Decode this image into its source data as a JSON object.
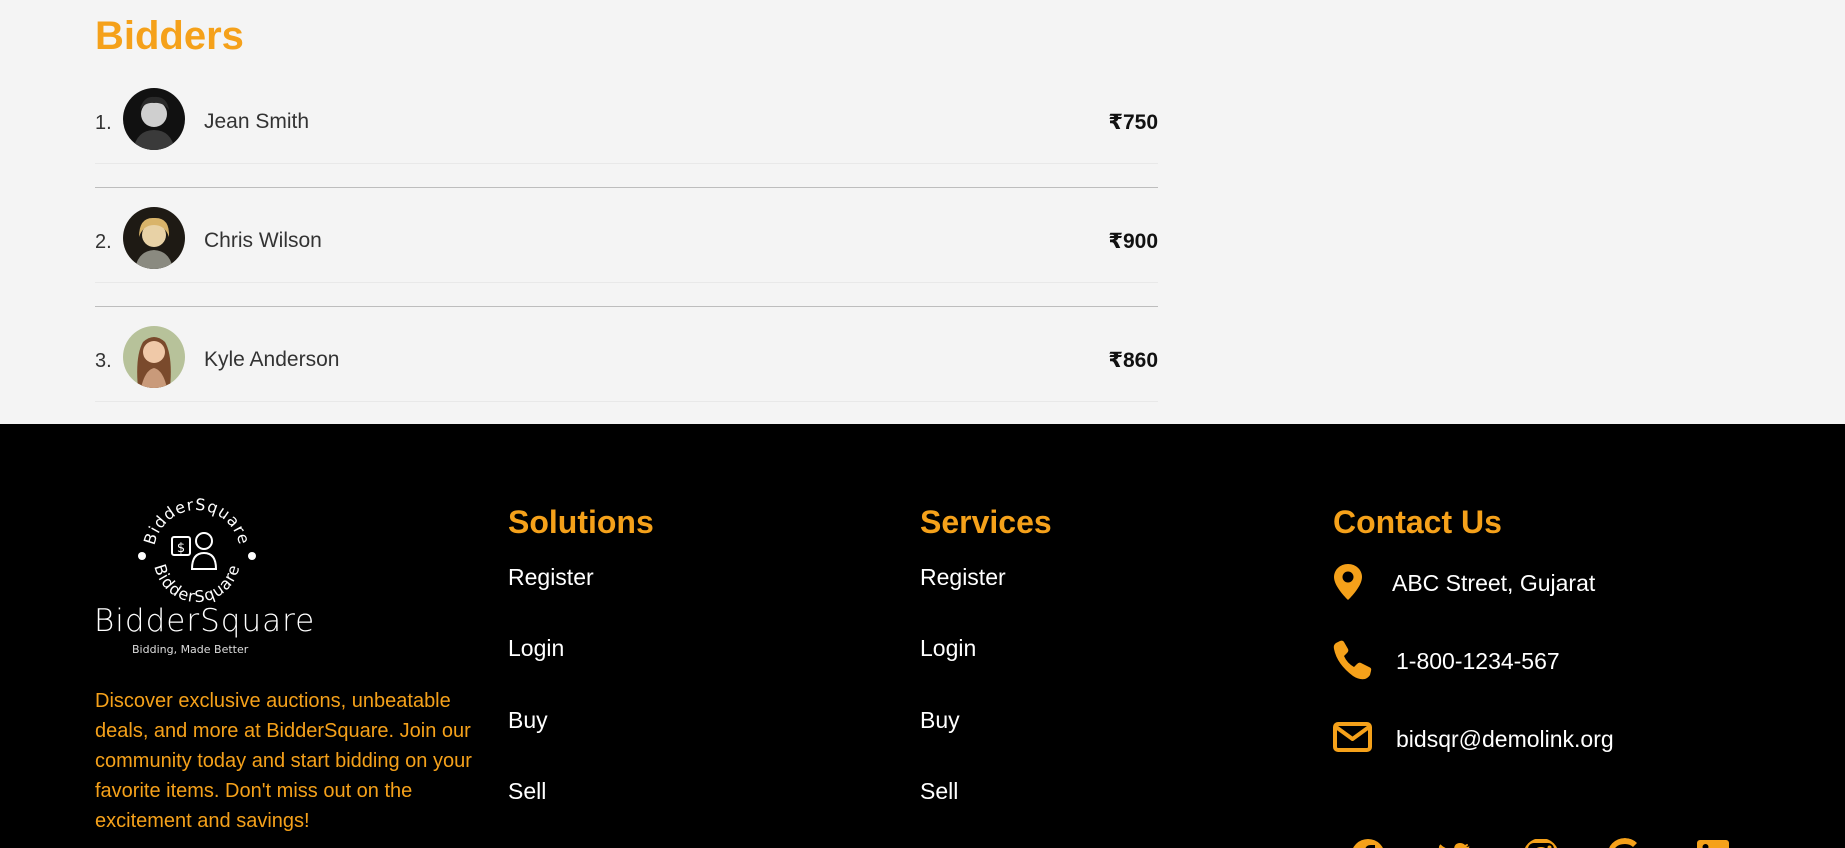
{
  "bidders": {
    "title": "Bidders",
    "items": [
      {
        "rank": "1.",
        "name": "Jean Smith",
        "amount": "₹750",
        "avatar": "person-dark-hair-portrait"
      },
      {
        "rank": "2.",
        "name": "Chris Wilson",
        "amount": "₹900",
        "avatar": "person-blonde-portrait"
      },
      {
        "rank": "3.",
        "name": "Kyle Anderson",
        "amount": "₹860",
        "avatar": "person-brown-hair-portrait"
      }
    ]
  },
  "footer": {
    "logo": {
      "arc_text": "BidderSquare",
      "wordmark": "BidderSquare",
      "tagline": "Bidding, Made Better"
    },
    "about": "Discover exclusive auctions, unbeatable deals, and more at BidderSquare. Join our community today and start bidding on your favorite items. Don't miss out on the excitement and savings!",
    "solutions": {
      "title": "Solutions",
      "links": [
        "Register",
        "Login",
        "Buy",
        "Sell"
      ]
    },
    "services": {
      "title": "Services",
      "links": [
        "Register",
        "Login",
        "Buy",
        "Sell"
      ]
    },
    "contact": {
      "title": "Contact Us",
      "address": "ABC Street, Gujarat",
      "phone": "1-800-1234-567",
      "email": "bidsqr@demolink.org",
      "icons": [
        "map-pin-icon",
        "phone-icon",
        "envelope-icon"
      ]
    },
    "social_icons": [
      "facebook-icon",
      "twitter-icon",
      "instagram-icon",
      "google-icon",
      "linkedin-icon"
    ]
  },
  "colors": {
    "accent": "#f5a11a",
    "footer_bg": "#000000",
    "page_bg": "#f4f4f4"
  }
}
